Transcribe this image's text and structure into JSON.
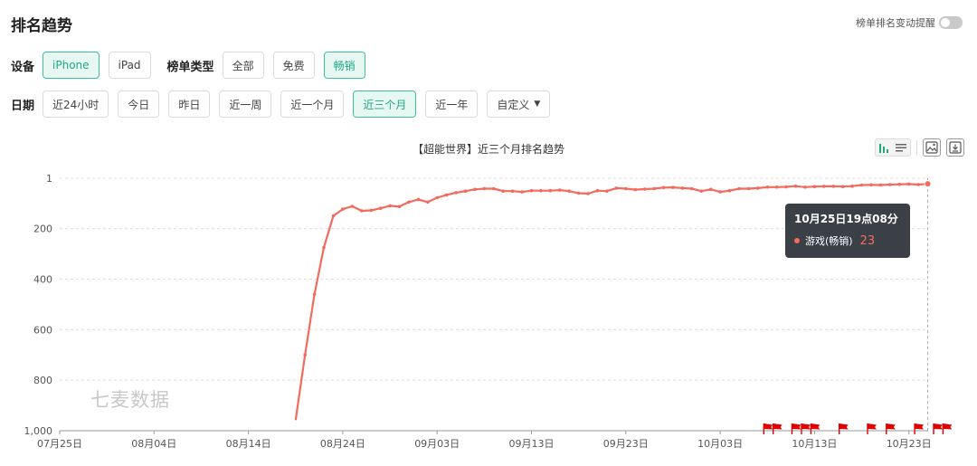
{
  "header": {
    "title": "排名趋势",
    "alert_label": "榜单排名变动提醒"
  },
  "filters": {
    "device_label": "设备",
    "devices": [
      "iPhone",
      "iPad"
    ],
    "device_active": 0,
    "type_label": "榜单类型",
    "types": [
      "全部",
      "免费",
      "畅销"
    ],
    "type_active": 2,
    "date_label": "日期",
    "dates": [
      "近24小时",
      "今日",
      "昨日",
      "近一周",
      "近一个月",
      "近三个月",
      "近一年",
      "自定义"
    ],
    "date_active": 5
  },
  "watermark": "七麦数据",
  "tooltip": {
    "time": "10月25日19点08分",
    "series": "游戏(畅销)",
    "value": "23"
  },
  "colors": {
    "accent": "#1fa784",
    "line": "#f26b5e",
    "flag": "#e00000"
  },
  "icons": [
    "bar-chart-icon",
    "list-icon",
    "image-icon",
    "download-icon",
    "flag-icon"
  ],
  "chart_data": {
    "type": "line",
    "title": "【超能世界】近三个月排名趋势",
    "yaxis_reversed": true,
    "ylim": [
      1,
      1000
    ],
    "yticks": [
      "1",
      "200",
      "400",
      "600",
      "800",
      "1,000"
    ],
    "ytick_values": [
      1,
      200,
      400,
      600,
      800,
      1000
    ],
    "xticks": [
      "07月25日",
      "08月04日",
      "08月14日",
      "08月24日",
      "09月03日",
      "09月13日",
      "09月23日",
      "10月03日",
      "10月13日",
      "10月23日"
    ],
    "grid": true,
    "series": [
      {
        "name": "游戏(畅销)",
        "x": [
          "2024-08-19",
          "2024-08-20",
          "2024-08-21",
          "2024-08-22",
          "2024-08-23",
          "2024-08-24",
          "2024-08-25",
          "2024-08-26",
          "2024-08-27",
          "2024-08-28",
          "2024-08-29",
          "2024-08-30",
          "2024-08-31",
          "2024-09-01",
          "2024-09-02",
          "2024-09-03",
          "2024-09-04",
          "2024-09-05",
          "2024-09-06",
          "2024-09-07",
          "2024-09-08",
          "2024-09-09",
          "2024-09-10",
          "2024-09-11",
          "2024-09-12",
          "2024-09-13",
          "2024-09-14",
          "2024-09-15",
          "2024-09-16",
          "2024-09-17",
          "2024-09-18",
          "2024-09-19",
          "2024-09-20",
          "2024-09-21",
          "2024-09-22",
          "2024-09-23",
          "2024-09-24",
          "2024-09-25",
          "2024-09-26",
          "2024-09-27",
          "2024-09-28",
          "2024-09-29",
          "2024-09-30",
          "2024-10-01",
          "2024-10-02",
          "2024-10-03",
          "2024-10-04",
          "2024-10-05",
          "2024-10-06",
          "2024-10-07",
          "2024-10-08",
          "2024-10-09",
          "2024-10-10",
          "2024-10-11",
          "2024-10-12",
          "2024-10-13",
          "2024-10-14",
          "2024-10-15",
          "2024-10-16",
          "2024-10-17",
          "2024-10-18",
          "2024-10-19",
          "2024-10-20",
          "2024-10-21",
          "2024-10-22",
          "2024-10-23",
          "2024-10-24",
          "2024-10-25"
        ],
        "values": [
          958,
          700,
          460,
          275,
          150,
          123,
          112,
          130,
          128,
          120,
          110,
          113,
          95,
          85,
          95,
          78,
          67,
          58,
          52,
          45,
          42,
          42,
          52,
          52,
          55,
          50,
          50,
          50,
          48,
          52,
          60,
          62,
          50,
          52,
          40,
          42,
          46,
          44,
          42,
          38,
          37,
          40,
          42,
          52,
          45,
          55,
          50,
          42,
          42,
          40,
          36,
          36,
          35,
          32,
          36,
          34,
          33,
          33,
          34,
          32,
          28,
          27,
          28,
          26,
          25,
          24,
          26,
          23
        ]
      }
    ],
    "event_flags": [
      "2024-10-08",
      "2024-10-09",
      "2024-10-11",
      "2024-10-12",
      "2024-10-13",
      "2024-10-16",
      "2024-10-19",
      "2024-10-21",
      "2024-10-24",
      "2024-10-26",
      "2024-10-27"
    ],
    "tooltip_index": 67
  }
}
